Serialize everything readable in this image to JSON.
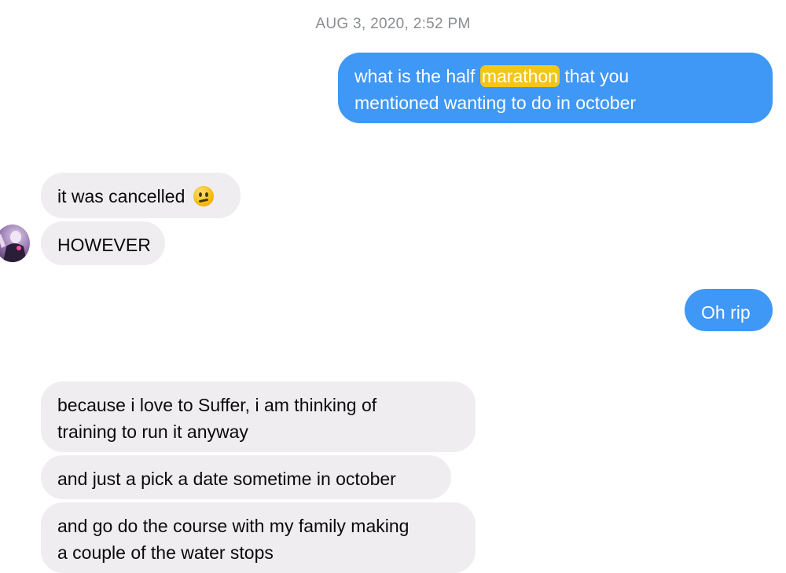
{
  "thread": {
    "timestamp": "AUG 3, 2020, 2:52 PM",
    "messages": [
      {
        "direction": "outgoing",
        "lines": [
          {
            "before": "what is the half ",
            "highlight": "marathon",
            "after": " that you"
          },
          {
            "text": "mentioned wanting to do in october"
          }
        ]
      },
      {
        "direction": "incoming",
        "text": "it was cancelled",
        "emoji": "confused-face-icon"
      },
      {
        "direction": "incoming",
        "text": "HOWEVER"
      },
      {
        "direction": "outgoing",
        "text": "Oh rip"
      },
      {
        "direction": "incoming",
        "lines": [
          "because i love to Suffer, i am thinking of",
          "training to run it anyway"
        ]
      },
      {
        "direction": "incoming",
        "text": "and just a pick a date sometime in october"
      },
      {
        "direction": "incoming",
        "lines": [
          "and go do the course with my family making",
          "a couple of the water stops"
        ]
      }
    ]
  },
  "colors": {
    "outgoing_bubble": "#3f97f6",
    "incoming_bubble": "#efedf0",
    "search_highlight": "#f5c518",
    "timestamp_text": "#8a8d91"
  }
}
